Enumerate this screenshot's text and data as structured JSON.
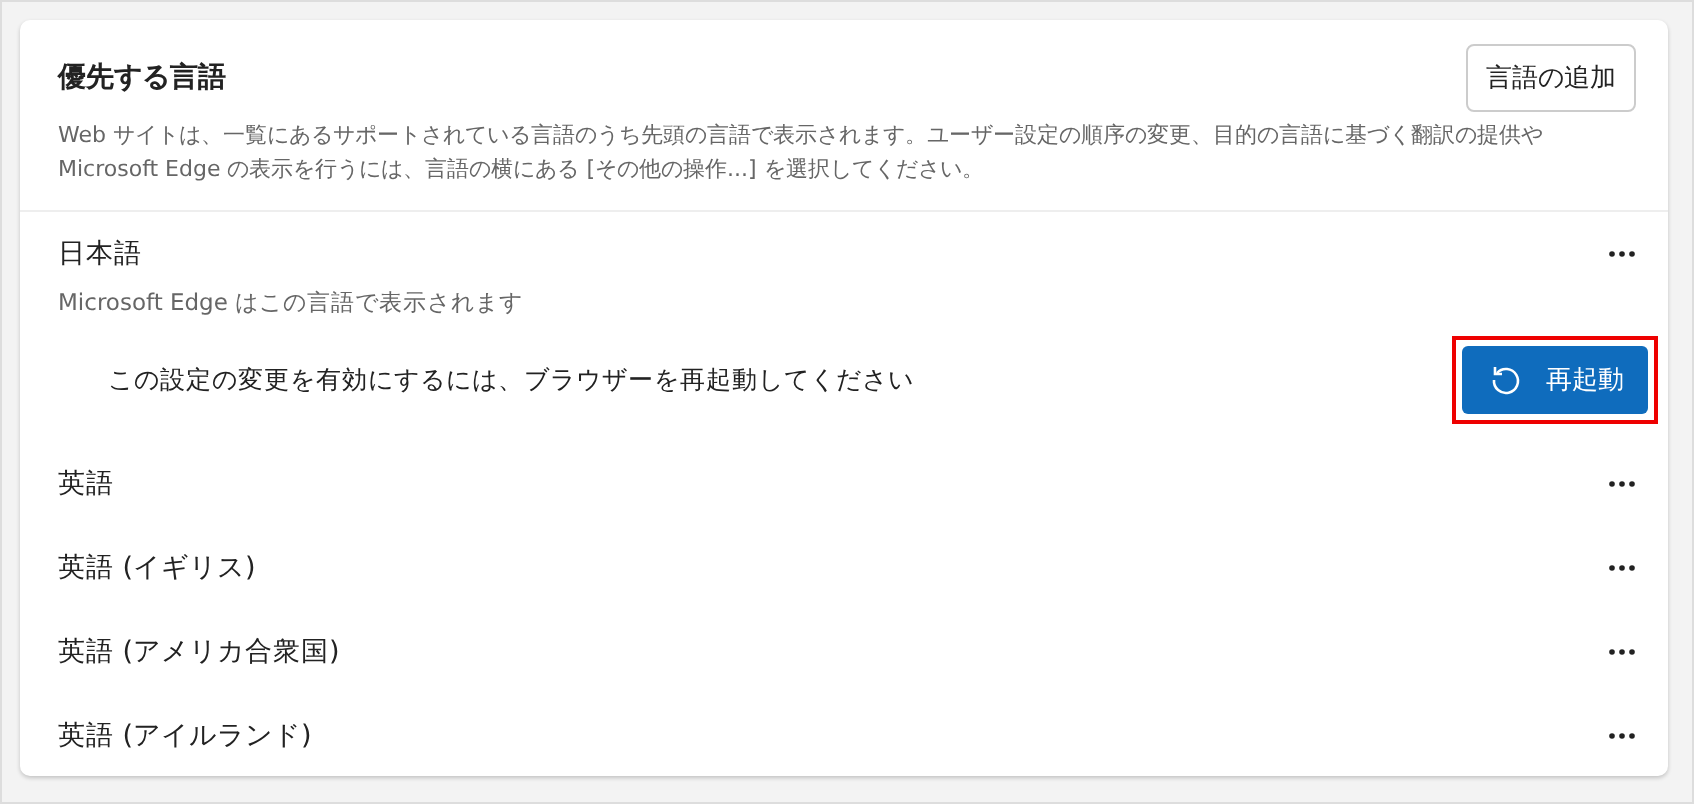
{
  "header": {
    "title": "優先する言語",
    "add_button": "言語の追加",
    "description": "Web サイトは、一覧にあるサポートされている言語のうち先頭の言語で表示されます。ユーザー設定の順序の変更、目的の言語に基づく翻訳の提供や Microsoft Edge の表示を行うには、言語の横にある [その他の操作...] を選択してください。"
  },
  "languages": [
    {
      "name": "日本語",
      "subtitle": "Microsoft Edge はこの言語で表示されます",
      "notice": "この設定の変更を有効にするには、ブラウザーを再起動してください",
      "restart_button": {
        "label": "再起動",
        "highlighted": true
      }
    },
    {
      "name": "英語"
    },
    {
      "name": "英語 (イギリス)"
    },
    {
      "name": "英語 (アメリカ合衆国)"
    },
    {
      "name": "英語 (アイルランド)"
    }
  ]
}
